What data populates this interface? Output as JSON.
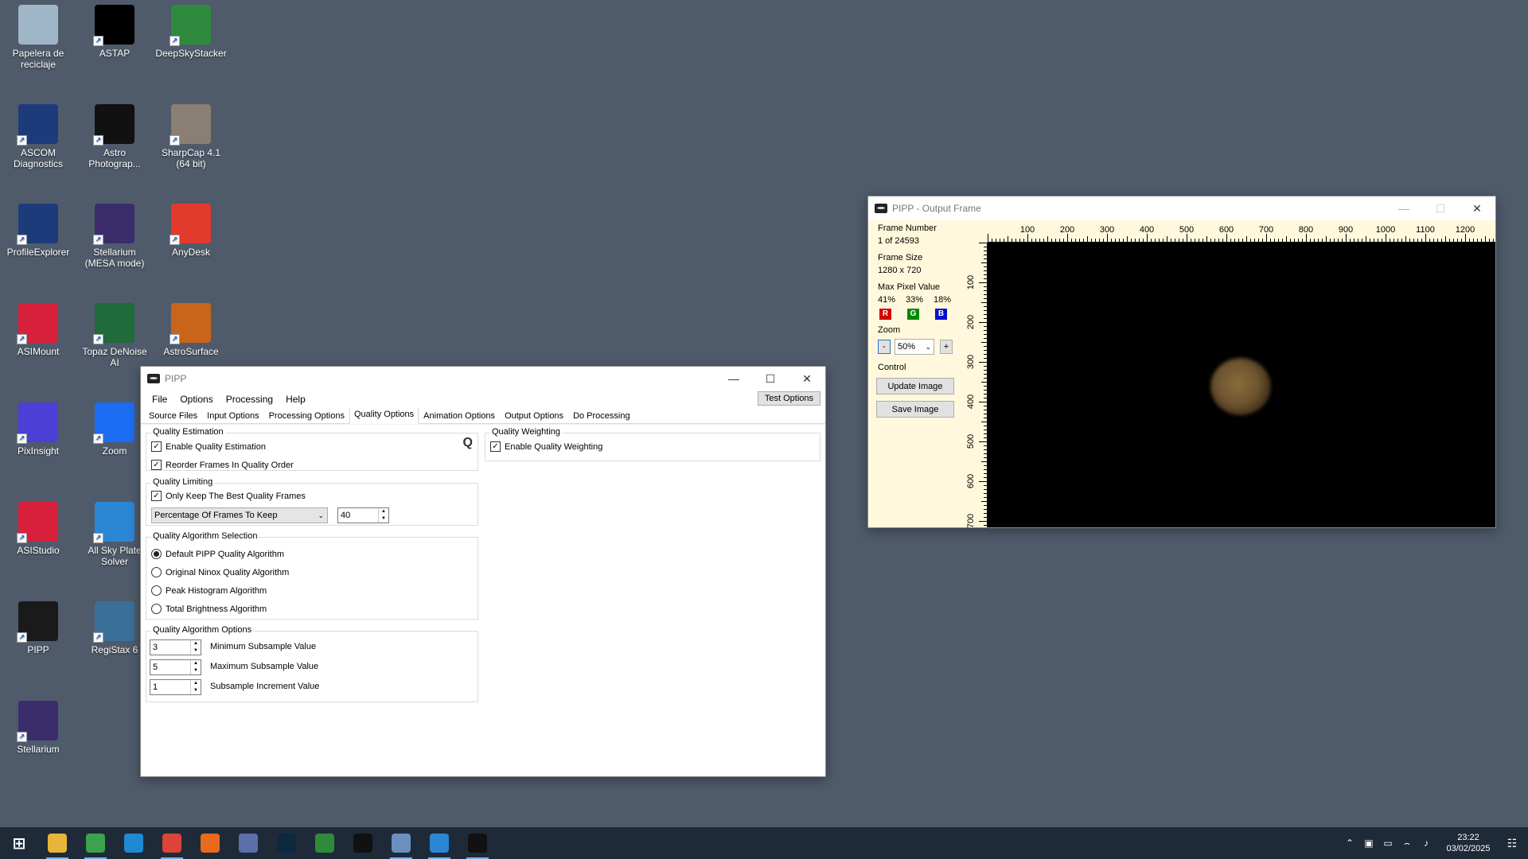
{
  "desktop": {
    "icons": [
      {
        "label": "Papelera de reciclaje",
        "icon": "recycle-bin-icon",
        "color": "#9fb6c9"
      },
      {
        "label": "ASTAP",
        "icon": "astap-icon",
        "color": "#000000"
      },
      {
        "label": "DeepSkyStacker",
        "icon": "deepskystacker-icon",
        "color": "#2e8b3d"
      },
      {
        "label": "ASCOM Diagnostics",
        "icon": "ascom-diagnostics-icon",
        "color": "#1d3a7a"
      },
      {
        "label": "Astro Photograp...",
        "icon": "astro-photography-tool-icon",
        "color": "#111111"
      },
      {
        "label": "SharpCap 4.1 (64 bit)",
        "icon": "sharpcap-icon",
        "color": "#8a7f74"
      },
      {
        "label": "ProfileExplorer",
        "icon": "profile-explorer-icon",
        "color": "#1d3a7a"
      },
      {
        "label": "Stellarium (MESA mode)",
        "icon": "stellarium-icon",
        "color": "#3b2d6b"
      },
      {
        "label": "AnyDesk",
        "icon": "anydesk-icon",
        "color": "#e23a2d"
      },
      {
        "label": "ASIMount",
        "icon": "asimount-icon",
        "color": "#d81f3c"
      },
      {
        "label": "Topaz DeNoise AI",
        "icon": "topaz-denoise-icon",
        "color": "#1f6b3a"
      },
      {
        "label": "AstroSurface",
        "icon": "astrosurface-icon",
        "color": "#c9651b"
      },
      {
        "label": "PixInsight",
        "icon": "pixinsight-icon",
        "color": "#4b3fd6"
      },
      {
        "label": "Zoom",
        "icon": "zoom-icon",
        "color": "#1b6df2"
      },
      {
        "label": "ASIStudio",
        "icon": "asistudio-icon",
        "color": "#d81f3c"
      },
      {
        "label": "All Sky Plate Solver",
        "icon": "all-sky-plate-solver-icon",
        "color": "#2c86d6"
      },
      {
        "label": "PIPP",
        "icon": "pipp-icon",
        "color": "#1a1a1a"
      },
      {
        "label": "RegiStax 6",
        "icon": "registax-icon",
        "color": "#3a6f9a"
      },
      {
        "label": "Stellarium",
        "icon": "stellarium-icon",
        "color": "#3b2d6b"
      }
    ]
  },
  "pipp": {
    "title": "PIPP",
    "menu": [
      "File",
      "Options",
      "Processing",
      "Help"
    ],
    "test_button": "Test Options",
    "tabs": [
      "Source Files",
      "Input Options",
      "Processing Options",
      "Quality Options",
      "Animation Options",
      "Output Options",
      "Do Processing"
    ],
    "quality_estimation": {
      "legend": "Quality Estimation",
      "enable": "Enable Quality Estimation",
      "reorder": "Reorder Frames In Quality Order",
      "q_glyph": "Q"
    },
    "quality_limiting": {
      "legend": "Quality Limiting",
      "only_keep": "Only Keep The Best Quality Frames",
      "mode": "Percentage Of Frames To Keep",
      "value": "40"
    },
    "algorithm_selection": {
      "legend": "Quality Algorithm Selection",
      "options": [
        "Default PIPP Quality Algorithm",
        "Original Ninox Quality Algorithm",
        "Peak Histogram Algorithm",
        "Total Brightness Algorithm"
      ]
    },
    "algorithm_options": {
      "legend": "Quality Algorithm Options",
      "min_value": "3",
      "min_label": "Minimum Subsample Value",
      "max_value": "5",
      "max_label": "Maximum Subsample Value",
      "inc_value": "1",
      "inc_label": "Subsample Increment Value"
    },
    "weighting": {
      "legend": "Quality Weighting",
      "enable": "Enable Quality Weighting"
    }
  },
  "output": {
    "title": "PIPP - Output Frame",
    "frame_number_label": "Frame Number",
    "frame_number": "1 of 24593",
    "frame_size_label": "Frame Size",
    "frame_size": "1280 x 720",
    "max_pixel_label": "Max Pixel Value",
    "r_pct": "41%",
    "g_pct": "33%",
    "b_pct": "18%",
    "r": "R",
    "g": "G",
    "b": "B",
    "zoom_label": "Zoom",
    "zoom_minus": "-",
    "zoom_plus": "+",
    "zoom_value": "50%",
    "control_label": "Control",
    "update_button": "Update Image",
    "save_button": "Save Image",
    "h_ticks": [
      "100",
      "200",
      "300",
      "400",
      "500",
      "600",
      "700",
      "800",
      "900",
      "1000",
      "1100",
      "1200"
    ],
    "v_ticks": [
      "100",
      "200",
      "300",
      "400",
      "500",
      "600",
      "700"
    ]
  },
  "taskbar": {
    "apps": [
      {
        "icon": "windows-start-icon",
        "color": "#1f2a38",
        "open": false
      },
      {
        "icon": "file-explorer-icon",
        "color": "#e8b53a",
        "open": true
      },
      {
        "icon": "notepad-icon",
        "color": "#3aa34b",
        "open": true
      },
      {
        "icon": "vscode-icon",
        "color": "#1f8ad2",
        "open": false
      },
      {
        "icon": "chrome-icon",
        "color": "#db4437",
        "open": true
      },
      {
        "icon": "firefox-icon",
        "color": "#e86a1c",
        "open": false
      },
      {
        "icon": "network-tool-icon",
        "color": "#5b6fa8",
        "open": false
      },
      {
        "icon": "lightroom-classic-icon",
        "color": "#0d2940",
        "open": false
      },
      {
        "icon": "green-app-icon",
        "color": "#2f8a3a",
        "open": false
      },
      {
        "icon": "astro-photography-tool-icon",
        "color": "#111111",
        "open": false
      },
      {
        "icon": "paint-app-icon",
        "color": "#6b8fbf",
        "open": true
      },
      {
        "icon": "astap-icon",
        "color": "#2c86d6",
        "open": true
      },
      {
        "icon": "pipp-icon",
        "color": "#111111",
        "open": true
      }
    ],
    "time": "23:22",
    "date": "03/02/2025"
  }
}
